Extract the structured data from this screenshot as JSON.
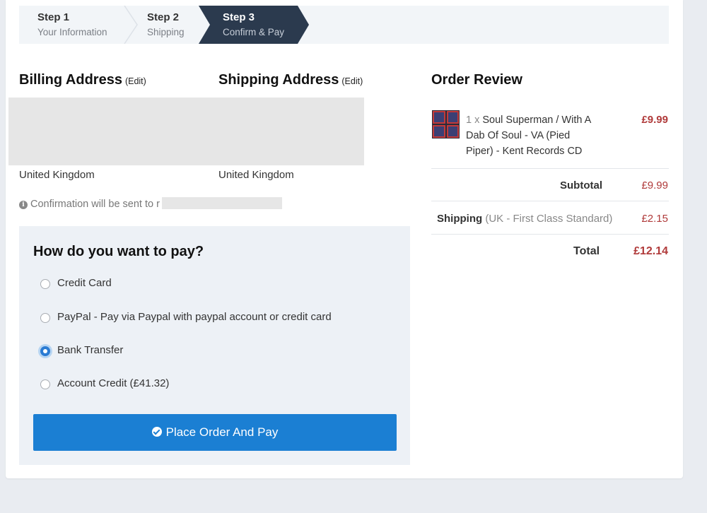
{
  "steps": [
    {
      "step": "Step 1",
      "name": "Your Information"
    },
    {
      "step": "Step 2",
      "name": "Shipping"
    },
    {
      "step": "Step 3",
      "name": "Confirm & Pay"
    }
  ],
  "billing": {
    "title": "Billing Address",
    "edit": "(Edit)",
    "country": "United Kingdom"
  },
  "shipping_address": {
    "title": "Shipping Address",
    "edit": "(Edit)",
    "country": "United Kingdom"
  },
  "confirmation_text": "Confirmation will be sent to r",
  "payment": {
    "title": "How do you want to pay?",
    "options": [
      {
        "label": "Credit Card",
        "selected": false
      },
      {
        "label": "PayPal - Pay via Paypal with paypal account or credit card",
        "selected": false
      },
      {
        "label": "Bank Transfer",
        "selected": true
      },
      {
        "label": "Account Credit (£41.32)",
        "selected": false
      }
    ],
    "submit_label": "Place Order And Pay"
  },
  "order_review": {
    "title": "Order Review",
    "item": {
      "qty": "1 x",
      "name": "Soul Superman / With A Dab Of Soul - VA (Pied Piper) - Kent Records CD",
      "price": "£9.99"
    },
    "subtotal_label": "Subtotal",
    "subtotal": "£9.99",
    "shipping_label": "Shipping",
    "shipping_method": "(UK - First Class Standard)",
    "shipping_cost": "£2.15",
    "total_label": "Total",
    "total": "£12.14"
  },
  "colors": {
    "accent": "#1b7fd3",
    "price": "#b03a3a",
    "step_active": "#2b3a4e"
  }
}
